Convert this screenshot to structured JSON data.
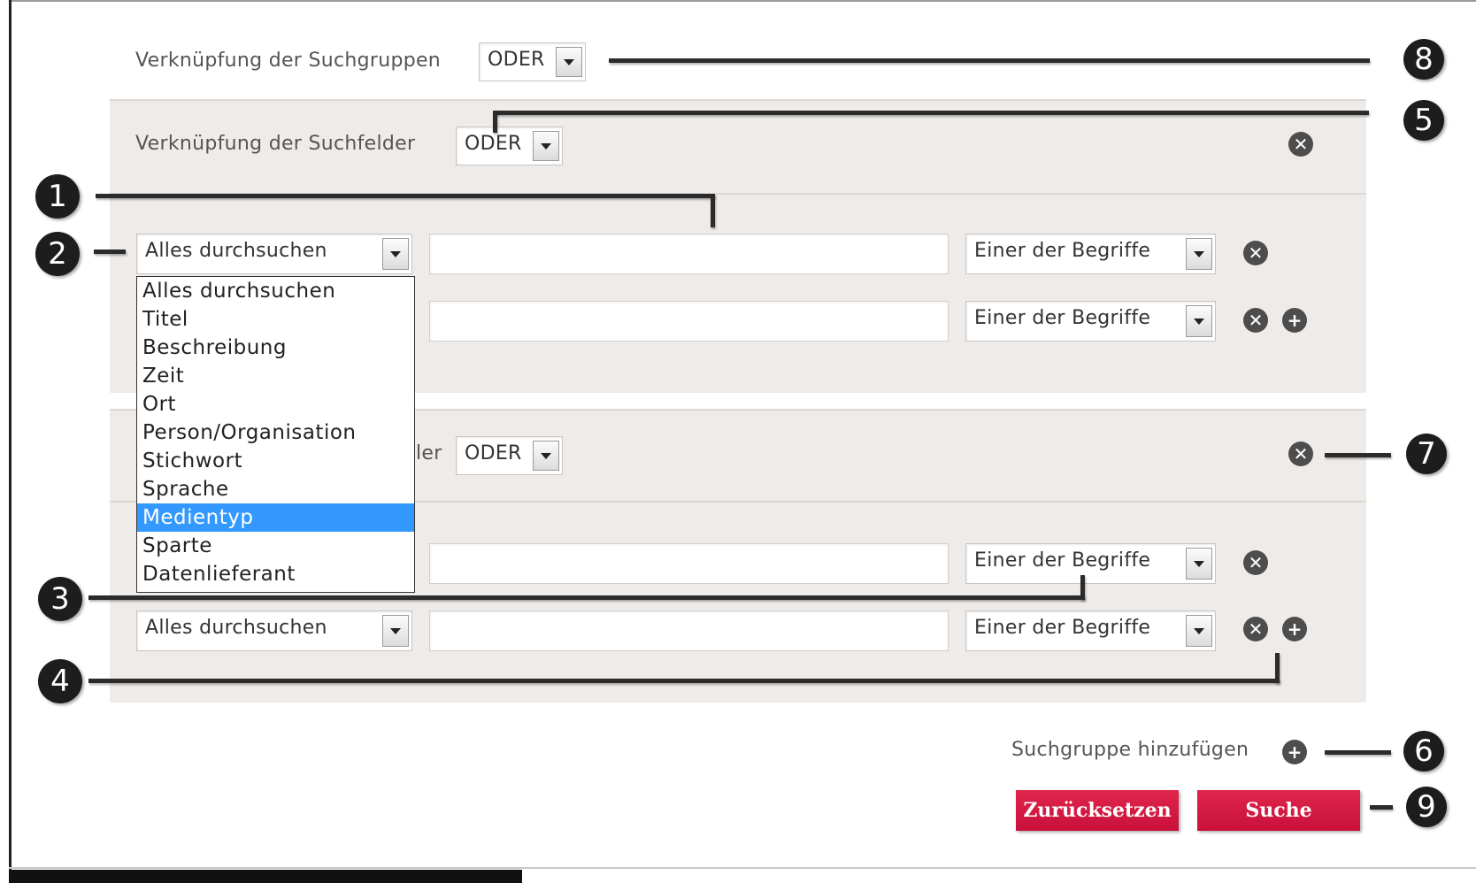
{
  "groups_link": {
    "label": "Verknüpfung der Suchgruppen",
    "value": "ODER"
  },
  "group1": {
    "fields_link": {
      "label": "Verknüpfung der Suchfelder",
      "value": "ODER"
    },
    "rows": [
      {
        "field": "Alles durchsuchen",
        "mode": "Einer der Begriffe"
      },
      {
        "field": "",
        "mode": "Einer der Begriffe"
      }
    ]
  },
  "group2": {
    "fields_link": {
      "label_visible": "ler",
      "value": "ODER"
    },
    "rows": [
      {
        "field": "",
        "mode": "Einer der Begriffe"
      },
      {
        "field": "Alles durchsuchen",
        "mode": "Einer der Begriffe"
      }
    ]
  },
  "dropdown": {
    "options": [
      "Alles durchsuchen",
      "Titel",
      "Beschreibung",
      "Zeit",
      "Ort",
      "Person/Organisation",
      "Stichwort",
      "Sprache",
      "Medientyp",
      "Sparte",
      "Datenlieferant"
    ],
    "highlighted": "Medientyp",
    "highlight_color": "#3399ff"
  },
  "add_group_label": "Suchgruppe hinzufügen",
  "buttons": {
    "reset": "Zurücksetzen",
    "search": "Suche",
    "color": "#d41a42"
  },
  "icons": {
    "remove": "close-icon",
    "add": "plus-icon",
    "remove_glyph": "✕",
    "add_glyph": "+"
  },
  "badges": [
    "1",
    "2",
    "3",
    "4",
    "5",
    "6",
    "7",
    "8",
    "9"
  ]
}
